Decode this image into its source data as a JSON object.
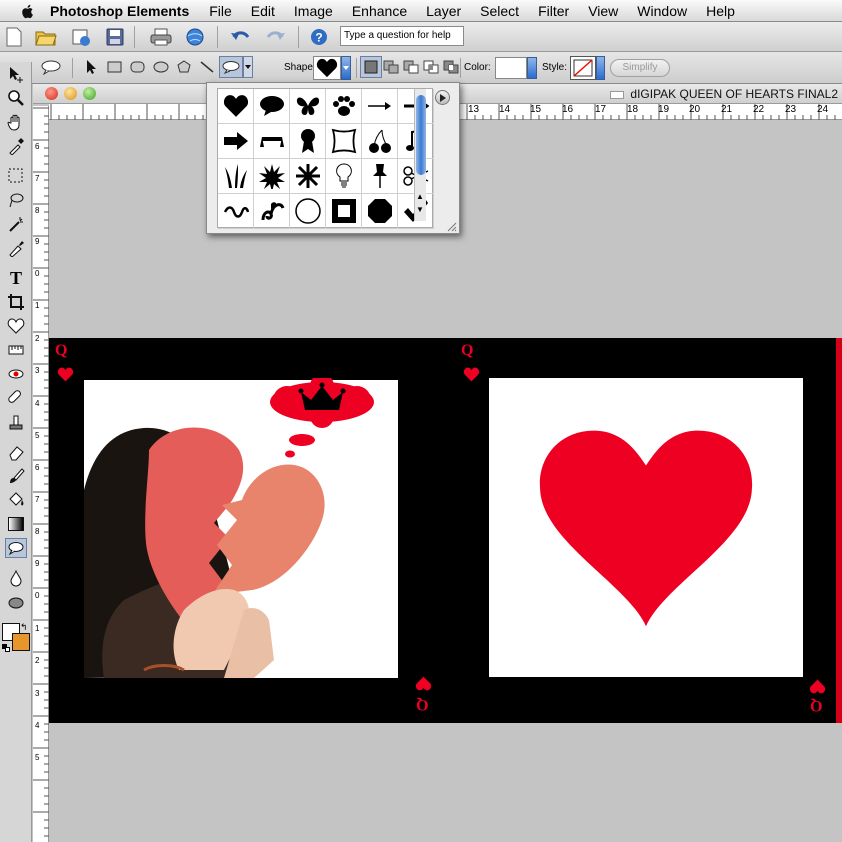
{
  "menubar": {
    "app_name": "Photoshop Elements",
    "items": [
      "File",
      "Edit",
      "Image",
      "Enhance",
      "Layer",
      "Select",
      "Filter",
      "View",
      "Window",
      "Help"
    ]
  },
  "toolbar": {
    "help_placeholder": "Type a question for help"
  },
  "options_bar": {
    "shape_label": "Shape:",
    "color_label": "Color:",
    "style_label": "Style:",
    "simplify_label": "Simplify"
  },
  "document": {
    "title": "dIGIPAK QUEEN OF HEARTS FINAL2"
  },
  "rulers": {
    "horizontal": [
      "13",
      "14",
      "15",
      "16",
      "17",
      "18",
      "19",
      "20",
      "21",
      "22",
      "23",
      "24"
    ],
    "vertical": [
      "6",
      "7",
      "8",
      "9",
      "0",
      "1",
      "2",
      "3",
      "4",
      "5",
      "6",
      "7",
      "8",
      "9",
      "0",
      "1",
      "2",
      "3",
      "4",
      "5"
    ]
  },
  "card": {
    "rank": "Q",
    "accent_color": "#ee0022"
  },
  "shape_picker": {
    "shapes": [
      "heart-shape",
      "speech-bubble",
      "butterfly",
      "paw-print",
      "thin-arrow",
      "bold-arrow",
      "block-arrow",
      "banner",
      "award-ribbon",
      "frame",
      "cherries",
      "music-note",
      "grass",
      "starburst",
      "snowflake",
      "light-bulb",
      "thumbtack",
      "scissors",
      "ornament",
      "flourish",
      "circle",
      "square-frame",
      "octagon",
      "checkmark"
    ]
  },
  "colors": {
    "app_background": "#c4c4c4",
    "selection_blue": "#3a78d6",
    "heart_red": "#ee0022"
  }
}
